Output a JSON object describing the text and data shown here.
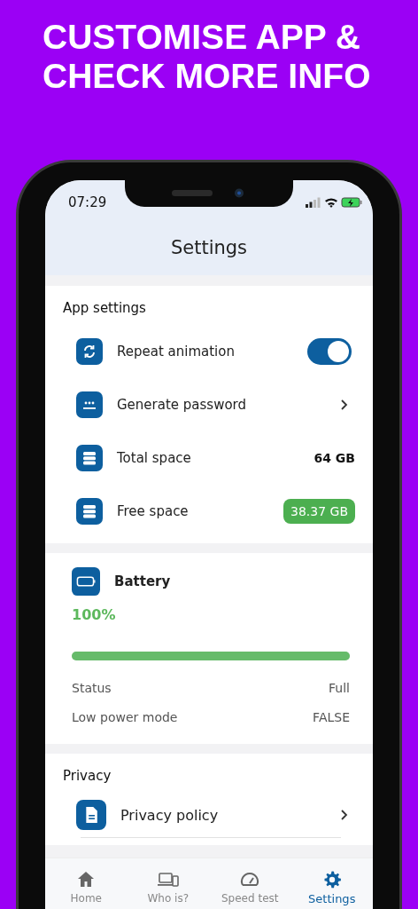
{
  "headline": "CUSTOMISE APP & CHECK MORE INFO",
  "status_bar": {
    "time": "07:29"
  },
  "header": {
    "title": "Settings"
  },
  "app_settings": {
    "title": "App settings",
    "items": [
      {
        "kind": "toggle",
        "label": "Repeat animation",
        "on": true
      },
      {
        "kind": "link",
        "label": "Generate password"
      },
      {
        "kind": "value",
        "label": "Total space",
        "value": "64 GB"
      },
      {
        "kind": "badge",
        "label": "Free space",
        "value": "38.37 GB"
      }
    ]
  },
  "battery": {
    "title": "Battery",
    "percent": "100%",
    "level": 1.0,
    "rows": [
      {
        "label": "Status",
        "value": "Full"
      },
      {
        "label": "Low power mode",
        "value": "FALSE"
      }
    ]
  },
  "privacy": {
    "title": "Privacy",
    "items": [
      {
        "kind": "link",
        "label": "Privacy policy"
      }
    ]
  },
  "tabs": [
    {
      "label": "Home",
      "selected": false
    },
    {
      "label": "Who is?",
      "selected": false
    },
    {
      "label": "Speed test",
      "selected": false
    },
    {
      "label": "Settings",
      "selected": true
    }
  ]
}
